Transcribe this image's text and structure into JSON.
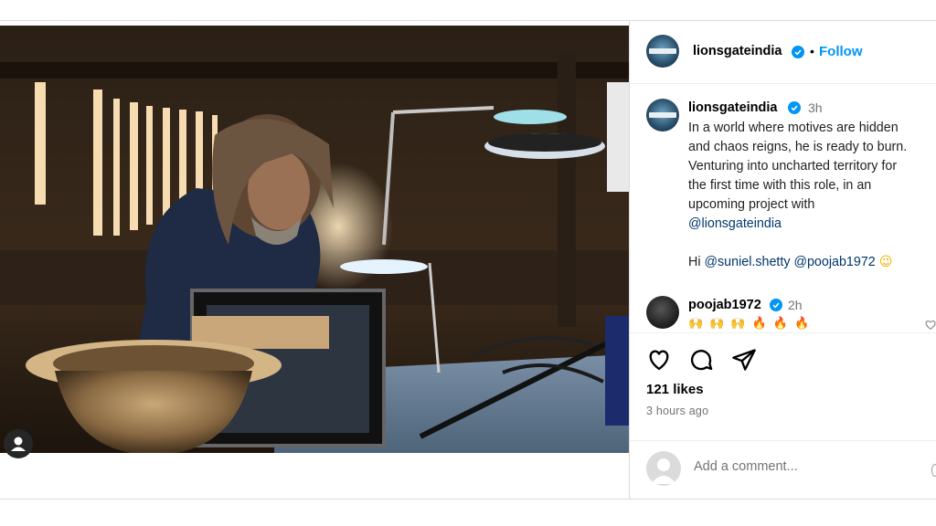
{
  "post": {
    "account": "lionsgateindia",
    "follow_label": "Follow",
    "separator": "•",
    "caption_time": "3h",
    "caption_lines": [
      "In a world where motives are hidden",
      "and chaos reigns, he is ready to burn.",
      "Venturing into uncharted territory for",
      "the first time with this role, in an",
      "upcoming project with"
    ],
    "caption_mention": "@lionsgateindia",
    "caption_hi": "Hi",
    "caption_mentions": [
      "@suniel.shetty",
      "@poojab1972"
    ],
    "caption_emoji": "😉"
  },
  "comment": {
    "user": "poojab1972",
    "time": "2h",
    "emojis": [
      {
        "glyph": "🙌",
        "type": "hands"
      },
      {
        "glyph": "🙌",
        "type": "hands"
      },
      {
        "glyph": "🙌",
        "type": "hands"
      },
      {
        "glyph": "🔥",
        "type": "fire"
      },
      {
        "glyph": "🔥",
        "type": "fire"
      },
      {
        "glyph": "🔥",
        "type": "fire"
      }
    ]
  },
  "actions": {
    "like_icon": "heart-icon",
    "comment_icon": "comment-icon",
    "share_icon": "share-icon"
  },
  "stats": {
    "likes": "121 likes",
    "posted": "3 hours ago"
  },
  "composer": {
    "placeholder": "Add a comment..."
  },
  "colors": {
    "link_blue": "#0095f6",
    "mention": "#00376b",
    "verified": "#0095f6",
    "muted": "#737373"
  }
}
